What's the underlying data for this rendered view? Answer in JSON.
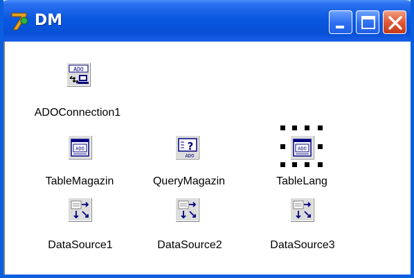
{
  "window": {
    "title": "DM"
  },
  "components": [
    {
      "name": "ADOConnection1",
      "icon": "ado-connection-icon"
    },
    {
      "name": "TableMagazin",
      "icon": "ado-table-icon"
    },
    {
      "name": "QueryMagazin",
      "icon": "ado-query-icon"
    },
    {
      "name": "TableLang",
      "icon": "ado-table-icon",
      "selected": true
    },
    {
      "name": "DataSource1",
      "icon": "datasource-icon"
    },
    {
      "name": "DataSource2",
      "icon": "datasource-icon"
    },
    {
      "name": "DataSource3",
      "icon": "datasource-icon"
    }
  ],
  "icon_text": {
    "ado": "ADO"
  },
  "colors": {
    "titlebar": "#0a58e0",
    "close": "#e05a3a",
    "icon_face": "#dcdcdc"
  }
}
